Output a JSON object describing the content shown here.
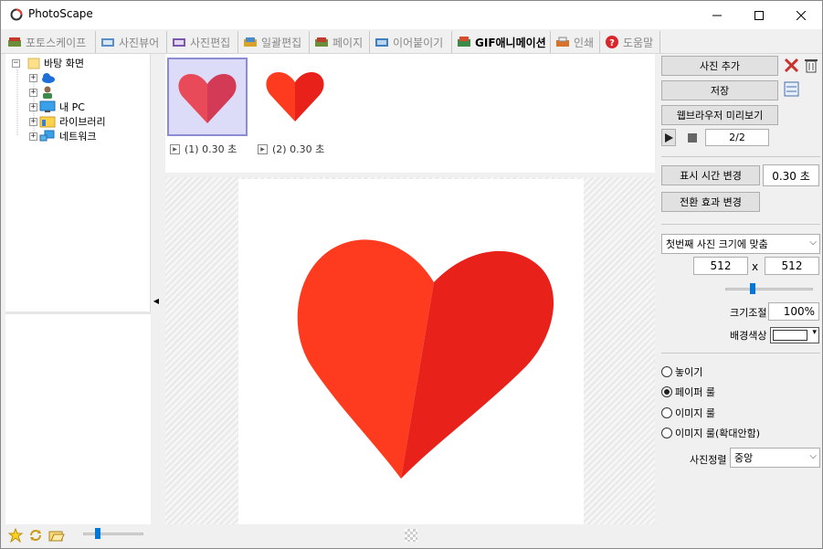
{
  "window": {
    "title": "PhotoScape",
    "controls": {
      "minimize": "–",
      "maximize": "☐",
      "close": "✕"
    }
  },
  "tabs": [
    {
      "label": "포토스케이프",
      "active": false
    },
    {
      "label": "사진뷰어",
      "active": false
    },
    {
      "label": "사진편집",
      "active": false
    },
    {
      "label": "일괄편집",
      "active": false
    },
    {
      "label": "페이지",
      "active": false
    },
    {
      "label": "이어붙이기",
      "active": false
    },
    {
      "label": "GIF애니메이션",
      "active": true
    },
    {
      "label": "인쇄",
      "active": false
    },
    {
      "label": "도움말",
      "active": false
    }
  ],
  "tree": {
    "root_label": "바탕 화면",
    "items": [
      {
        "label": "",
        "icon": "onedrive-icon"
      },
      {
        "label": "",
        "icon": "user-icon"
      },
      {
        "label": "내 PC",
        "icon": "pc-icon"
      },
      {
        "label": "라이브러리",
        "icon": "library-icon"
      },
      {
        "label": "네트워크",
        "icon": "network-icon"
      }
    ]
  },
  "frames": [
    {
      "caption": "(1) 0.30 초",
      "selected": true
    },
    {
      "caption": "(2) 0.30 초",
      "selected": false
    }
  ],
  "right_panel": {
    "add_photo": "사진 추가",
    "save": "저장",
    "browser_preview": "웹브라우저 미리보기",
    "frame_counter": "2/2",
    "display_time_change": "표시 시간 변경",
    "display_time_value": "0.30 초",
    "transition_change": "전환 효과 변경",
    "size_mode": "첫번째 사진 크기에 맞춤",
    "width": "512",
    "x_label": "x",
    "height": "512",
    "resize_label": "크기조절",
    "resize_value": "100%",
    "resize_slider_fraction": 0.3,
    "bg_color_label": "배경색상",
    "bg_color": "#ffffff",
    "placement_options": [
      {
        "label": "놓이기",
        "selected": false
      },
      {
        "label": "페이퍼 룰",
        "selected": true
      },
      {
        "label": "이미지 룰",
        "selected": false
      },
      {
        "label": "이미지 룰(확대안함)",
        "selected": false
      }
    ],
    "align_label": "사진정렬",
    "align_value": "중앙"
  },
  "bottom": {
    "zoom_slider_fraction": 0.2
  },
  "colors": {
    "heart_left": "#ff3b1f",
    "heart_right": "#e8211a",
    "heart_thumb1_left": "#e84a5a",
    "heart_thumb1_right": "#d23a55",
    "selection_bg": "#dcdcf8",
    "selection_border": "#8b8bd6"
  }
}
